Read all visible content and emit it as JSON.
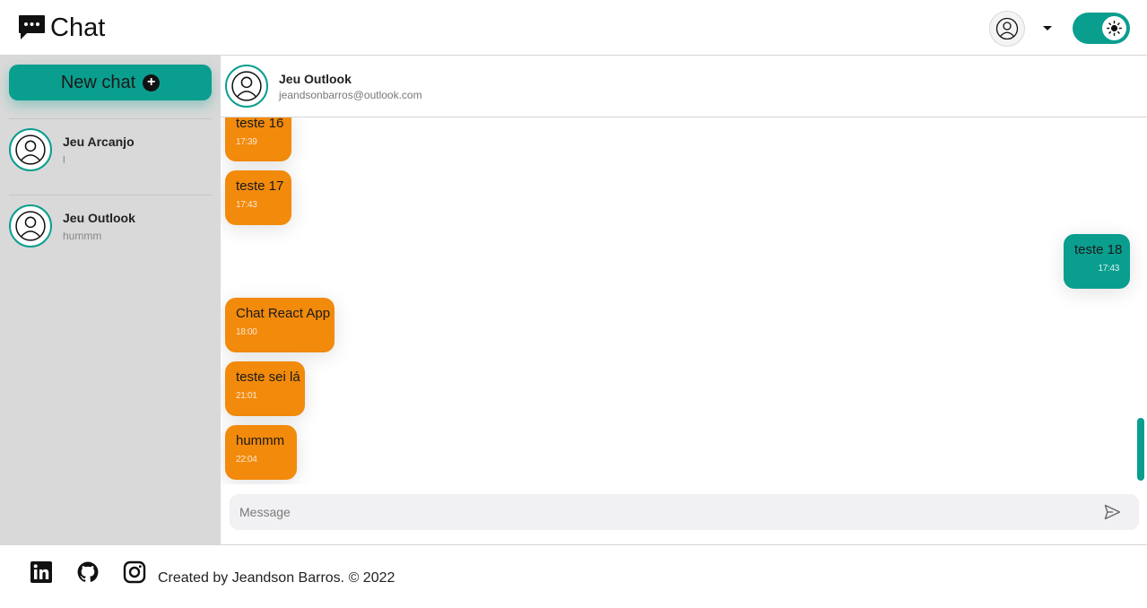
{
  "app": {
    "title": "Chat"
  },
  "header": {
    "account_icon": "user-circle-icon",
    "menu_icon": "caret-down-icon",
    "theme_icon": "sun-icon"
  },
  "sidebar": {
    "new_chat_label": "New chat",
    "contacts": [
      {
        "name": "Jeu Arcanjo",
        "last_message": "l"
      },
      {
        "name": "Jeu Outlook",
        "last_message": "hummm"
      }
    ]
  },
  "chat": {
    "contact_name": "Jeu Outlook",
    "contact_email": "jeandsonbarros@outlook.com",
    "messages": [
      {
        "text": "teste 16",
        "time": "17:39",
        "direction": "in"
      },
      {
        "text": "teste 17",
        "time": "17:43",
        "direction": "in"
      },
      {
        "text": "teste 18",
        "time": "17:43",
        "direction": "out"
      },
      {
        "text": "Chat React App",
        "time": "18:00",
        "direction": "in"
      },
      {
        "text": "teste sei lá",
        "time": "21:01",
        "direction": "in"
      },
      {
        "text": "hummm",
        "time": "22:04",
        "direction": "in"
      }
    ],
    "composer_placeholder": "Message"
  },
  "footer": {
    "credit": "Created by Jeandson Barros. © 2022",
    "social_icons": [
      "linkedin-icon",
      "github-icon",
      "instagram-icon"
    ]
  },
  "colors": {
    "accent": "#0a9e8f",
    "incoming_bubble": "#f28a0c",
    "sidebar_bg": "#d9d9d9"
  }
}
